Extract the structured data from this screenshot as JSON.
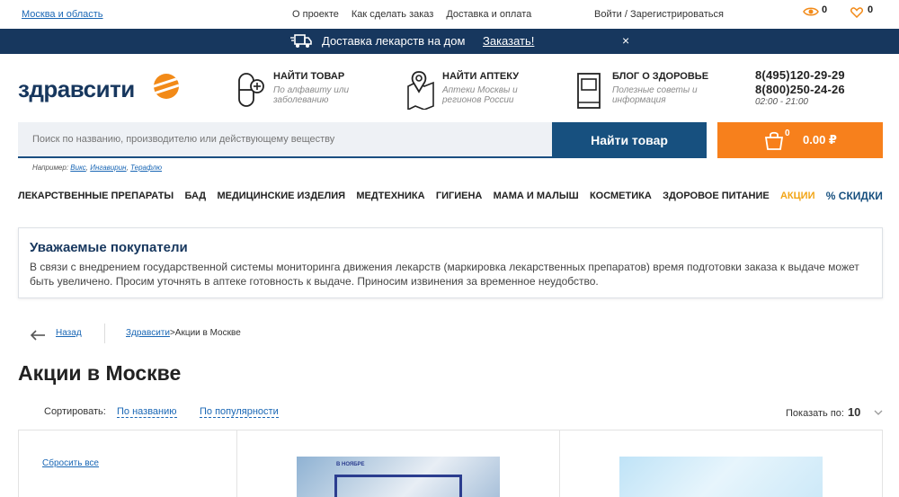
{
  "topbar": {
    "region": "Москва и область",
    "links": [
      "О проекте",
      "Как сделать заказ",
      "Доставка и оплата"
    ],
    "login": "Войти / Зарегистрироваться",
    "viewed_count": "0",
    "favorites_count": "0"
  },
  "banner": {
    "text": "Доставка лекарств на дом",
    "order": "Заказать!",
    "close": "×"
  },
  "header": {
    "logo": "здравсити",
    "blocks": [
      {
        "title": "НАЙТИ ТОВАР",
        "sub": "По алфавиту или заболеванию"
      },
      {
        "title": "НАЙТИ АПТЕКУ",
        "sub": "Аптеки Москвы и регионов России"
      },
      {
        "title": "БЛОГ О ЗДОРОВЬЕ",
        "sub": "Полезные советы и информация"
      }
    ],
    "phone1": "8(495)120-29-29",
    "phone2": "8(800)250-24-26",
    "hours": "02:00 - 21:00"
  },
  "search": {
    "placeholder": "Поиск по названию, производителю или действующему веществу",
    "button": "Найти товар",
    "examples_label": "Например:",
    "examples": [
      "Викс",
      "Ингавирин",
      "Терафлю"
    ]
  },
  "cart": {
    "count": "0",
    "sum": "0.00 ₽"
  },
  "nav": {
    "items": [
      "ЛЕКАРСТВЕННЫЕ ПРЕПАРАТЫ",
      "БАД",
      "МЕДИЦИНСКИЕ ИЗДЕЛИЯ",
      "МЕДТЕХНИКА",
      "ГИГИЕНА",
      "МАМА И МАЛЫШ",
      "КОСМЕТИКА",
      "ЗДОРОВОЕ ПИТАНИЕ"
    ],
    "promo": "АКЦИИ",
    "discounts": "% СКИДКИ"
  },
  "notice": {
    "title": "Уважаемые покупатели",
    "text": "В связи с внедрением государственной системы мониторинга движения лекарств (маркировка лекарственных препаратов) время подготовки заказа к выдаче может быть увеличено. Просим уточнять в аптеке готовность к выдаче. Приносим извинения за временное неудобство."
  },
  "breadcrumbs": {
    "back": "Назад",
    "home": "Здравсити",
    "current": "Акции в Москве"
  },
  "page_title": "Акции в Москве",
  "sort": {
    "label": "Сортировать:",
    "by_name": "По названию",
    "by_popularity": "По популярности"
  },
  "show": {
    "label": "Показать по:",
    "value": "10"
  },
  "filters": {
    "reset": "Сбросить все"
  },
  "cards": [
    {
      "label": "В НОЯБРЕ"
    }
  ]
}
